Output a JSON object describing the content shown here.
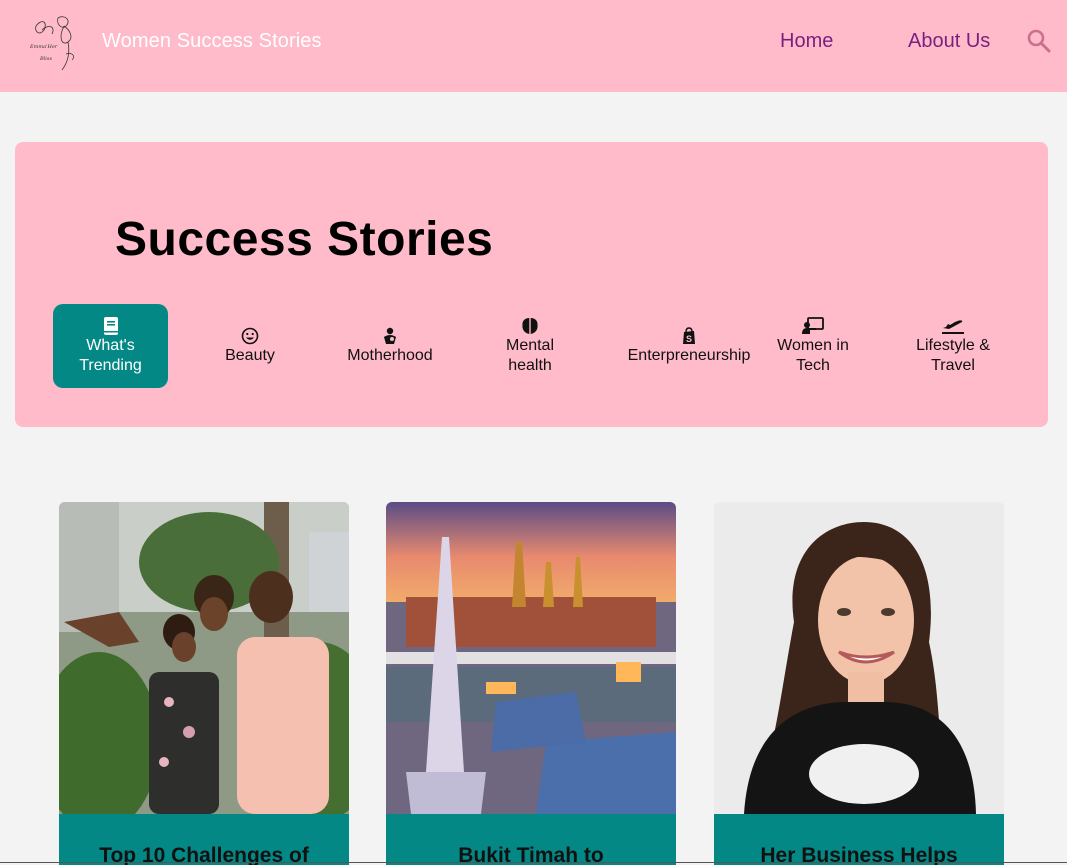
{
  "header": {
    "brand": "Women Success Stories",
    "logo_icon": "flower-logo-icon",
    "nav": [
      {
        "label": "Home"
      },
      {
        "label": "About Us"
      }
    ],
    "search_icon": "search-icon",
    "colors": {
      "background": "#ffbbc9",
      "nav_text": "#7a1f7f",
      "brand_text": "#ffffff"
    }
  },
  "hero": {
    "title": "Success Stories",
    "categories": [
      {
        "label": "What's Trending",
        "icon": "book-icon",
        "active": true
      },
      {
        "label": "Beauty",
        "icon": "smiley-icon",
        "active": false
      },
      {
        "label": "Motherhood",
        "icon": "baby-icon",
        "active": false
      },
      {
        "label": "Mental health",
        "icon": "brain-icon",
        "active": false
      },
      {
        "label": "Enterpreneurship",
        "icon": "shopify-icon",
        "active": false
      },
      {
        "label": "Women in Tech",
        "icon": "teacher-screen-icon",
        "active": false
      },
      {
        "label": "Lifestyle & Travel",
        "icon": "plane-departure-icon",
        "active": false
      }
    ],
    "colors": {
      "panel": "#ffbbc9",
      "active": "#038886"
    }
  },
  "cards": [
    {
      "title": "Top 10 Challenges of",
      "image": "family-photo"
    },
    {
      "title": "Bukit Timah to",
      "image": "temple-cityscape-photo"
    },
    {
      "title": "Her Business Helps",
      "image": "smiling-woman-photo"
    }
  ]
}
